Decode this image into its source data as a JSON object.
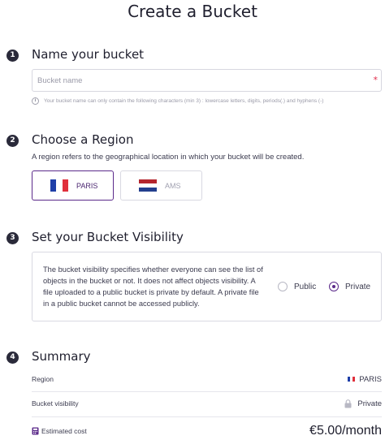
{
  "page": {
    "title": "Create a Bucket"
  },
  "colors": {
    "accent": "#5b2a8a",
    "step_badge": "#2a2a3a",
    "required": "#e02b4a"
  },
  "steps": [
    {
      "number": "1",
      "title": "Name your bucket"
    },
    {
      "number": "2",
      "title": "Choose a Region"
    },
    {
      "number": "3",
      "title": "Set your Bucket Visibility"
    },
    {
      "number": "4",
      "title": "Summary"
    }
  ],
  "name_section": {
    "placeholder": "Bucket name",
    "value": "",
    "required_mark": "*",
    "help_icon": "info-icon",
    "help_text": "Your bucket name can only contain the following characters (min 3) : lowercase letters, digits, periods(.) and hyphens (-)"
  },
  "region_section": {
    "subtitle": "A region refers to the geographical location in which your bucket will be created.",
    "options": [
      {
        "label": "PARIS",
        "flag": "fr-flag-icon",
        "selected": true
      },
      {
        "label": "AMS",
        "flag": "nl-flag-icon",
        "selected": false
      }
    ]
  },
  "visibility_section": {
    "description": "The bucket visibility specifies whether everyone can see the list of objects in the bucket or not. It does not affect objects visibility. A file uploaded to a public bucket is private by default. A private file in a public bucket cannot be accessed publicly.",
    "options": [
      {
        "label": "Public",
        "selected": false
      },
      {
        "label": "Private",
        "selected": true
      }
    ]
  },
  "summary": {
    "region_label": "Region",
    "region_value": "PARIS",
    "region_icon": "fr-flag-icon",
    "visibility_label": "Bucket visibility",
    "visibility_value": "Private",
    "visibility_icon": "lock-icon",
    "cost_label": "Estimated cost",
    "cost_icon": "calculator-icon",
    "cost_value": "€5.00/month"
  }
}
